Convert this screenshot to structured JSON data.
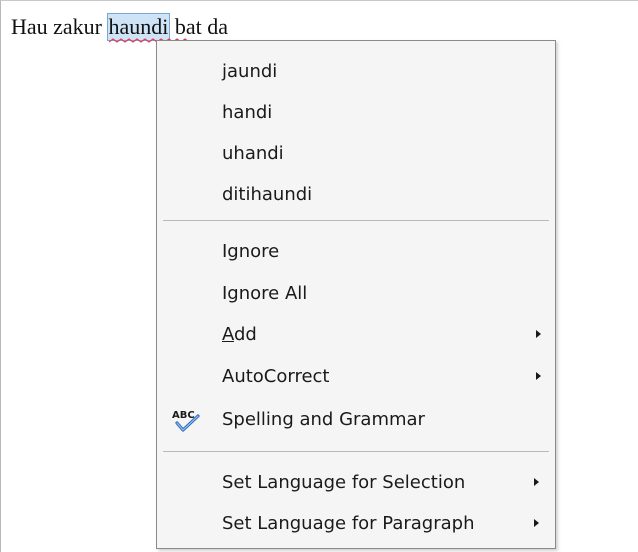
{
  "document": {
    "before": "Hau zakur ",
    "misspelled_word": "haundi",
    "after": " bat da"
  },
  "context_menu": {
    "suggestions": [
      "jaundi",
      "handi",
      "uhandi",
      "ditihaundi"
    ],
    "ignore": "Ignore",
    "ignore_all": "Ignore All",
    "add_accel": "A",
    "add_rest": "dd",
    "autocorrect": "AutoCorrect",
    "spelling_and_grammar": "Spelling and Grammar",
    "spelling_icon_text": "ABC",
    "set_language_selection": "Set Language for Selection",
    "set_language_paragraph": "Set Language for Paragraph"
  },
  "colors": {
    "selection": "#cfe3f7",
    "squiggle": "#e0405a",
    "menu_bg": "#f5f5f5",
    "check": "#2f6fc4"
  },
  "icons": {
    "spelling": "spelling-check-icon",
    "submenu": "submenu-arrow-icon"
  }
}
